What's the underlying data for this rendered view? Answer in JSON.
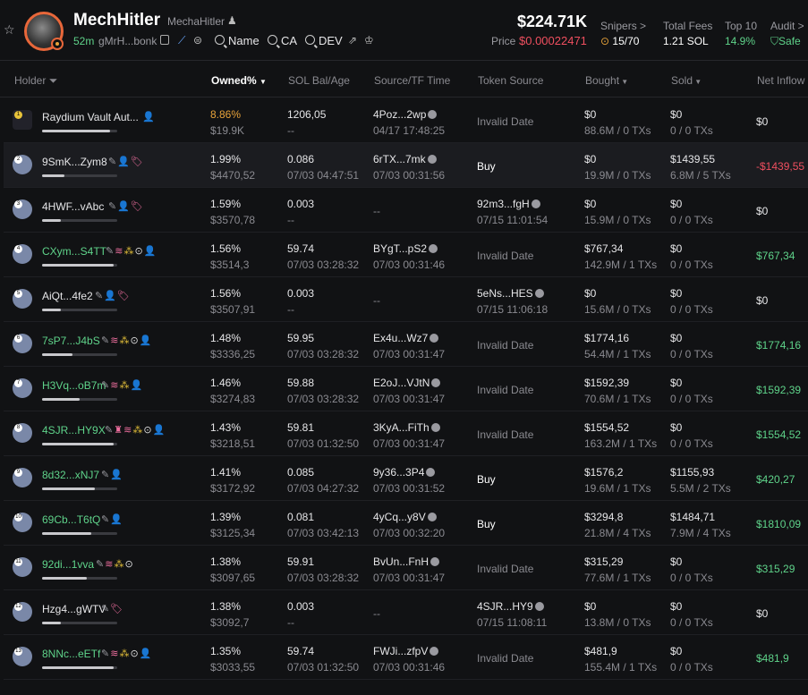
{
  "header": {
    "title": "MechHitler",
    "subtitle": "MechaHitler",
    "age": "52m",
    "ca_short": "gMrH...bonk",
    "name_link": "Name",
    "ca_link": "CA",
    "dev_link": "DEV",
    "market_cap": "$224.71K",
    "price_label": "Price",
    "price_value": "$0.00022471",
    "snipers_label": "Snipers >",
    "snipers_value": "15/70",
    "fees_label": "Total Fees",
    "fees_value": "1.21 SOL",
    "top10_label": "Top 10",
    "top10_value": "14.9%",
    "audit_label": "Audit >",
    "audit_value": "Safe"
  },
  "columns": {
    "holder": "Holder",
    "owned": "Owned%",
    "sol_bal": "SOL Bal/Age",
    "source": "Source/TF Time",
    "token_source": "Token Source",
    "bought": "Bought",
    "sold": "Sold",
    "net": "Net Inflow"
  },
  "rows": [
    {
      "rank": "1",
      "name": "Raydium Vault Aut...",
      "owned": "8.86%",
      "usd": "$19.9K",
      "bal": "1206,05",
      "age": "--",
      "src": "4Poz...2wp",
      "src_time": "04/17 17:48:25",
      "token": "Invalid Date",
      "token_time": "",
      "bought": "$0",
      "bought_sub": "88.6M / 0 TXs",
      "sold": "$0",
      "sold_sub": "0 / 0 TXs",
      "net": "$0",
      "bar": 0.9
    },
    {
      "rank": "2",
      "name": "9SmK...Zym8",
      "owned": "1.99%",
      "usd": "$4470,52",
      "bal": "0.086",
      "age": "07/03 04:47:51",
      "src": "6rTX...7mk",
      "src_time": "07/03 00:31:56",
      "token": "Buy",
      "token_time": "",
      "bought": "$0",
      "bought_sub": "19.9M / 0 TXs",
      "sold": "$1439,55",
      "sold_sub": "6.8M / 5 TXs",
      "net": "-$1439,55",
      "bar": 0.3
    },
    {
      "rank": "3",
      "name": "4HWF...vAbc",
      "owned": "1.59%",
      "usd": "$3570,78",
      "bal": "0.003",
      "age": "--",
      "src": "--",
      "src_time": "",
      "token": "92m3...fgH",
      "token_time": "07/15 11:01:54",
      "bought": "$0",
      "bought_sub": "15.9M / 0 TXs",
      "sold": "$0",
      "sold_sub": "0 / 0 TXs",
      "net": "$0",
      "bar": 0.25
    },
    {
      "rank": "4",
      "name": "CXym...S4TT",
      "owned": "1.56%",
      "usd": "$3514,3",
      "bal": "59.74",
      "age": "07/03 03:28:32",
      "src": "BYgT...pS2",
      "src_time": "07/03 00:31:46",
      "token": "Invalid Date",
      "token_time": "",
      "bought": "$767,34",
      "bought_sub": "142.9M / 1 TXs",
      "sold": "$0",
      "sold_sub": "0 / 0 TXs",
      "net": "$767,34",
      "bar": 0.95
    },
    {
      "rank": "5",
      "name": "AiQt...4fe2",
      "owned": "1.56%",
      "usd": "$3507,91",
      "bal": "0.003",
      "age": "--",
      "src": "--",
      "src_time": "",
      "token": "5eNs...HES",
      "token_time": "07/15 11:06:18",
      "bought": "$0",
      "bought_sub": "15.6M / 0 TXs",
      "sold": "$0",
      "sold_sub": "0 / 0 TXs",
      "net": "$0",
      "bar": 0.25
    },
    {
      "rank": "6",
      "name": "7sP7...J4bS",
      "owned": "1.48%",
      "usd": "$3336,25",
      "bal": "59.95",
      "age": "07/03 03:28:32",
      "src": "Ex4u...Wz7",
      "src_time": "07/03 00:31:47",
      "token": "Invalid Date",
      "token_time": "",
      "bought": "$1774,16",
      "bought_sub": "54.4M / 1 TXs",
      "sold": "$0",
      "sold_sub": "0 / 0 TXs",
      "net": "$1774,16",
      "bar": 0.4
    },
    {
      "rank": "7",
      "name": "H3Vq...oB7m",
      "owned": "1.46%",
      "usd": "$3274,83",
      "bal": "59.88",
      "age": "07/03 03:28:32",
      "src": "E2oJ...VJtN",
      "src_time": "07/03 00:31:47",
      "token": "Invalid Date",
      "token_time": "",
      "bought": "$1592,39",
      "bought_sub": "70.6M / 1 TXs",
      "sold": "$0",
      "sold_sub": "0 / 0 TXs",
      "net": "$1592,39",
      "bar": 0.5
    },
    {
      "rank": "8",
      "name": "4SJR...HY9X",
      "owned": "1.43%",
      "usd": "$3218,51",
      "bal": "59.81",
      "age": "07/03 01:32:50",
      "src": "3KyA...FiTh",
      "src_time": "07/03 00:31:47",
      "token": "Invalid Date",
      "token_time": "",
      "bought": "$1554,52",
      "bought_sub": "163.2M / 1 TXs",
      "sold": "$0",
      "sold_sub": "0 / 0 TXs",
      "net": "$1554,52",
      "bar": 0.95
    },
    {
      "rank": "9",
      "name": "8d32...xNJ7",
      "owned": "1.41%",
      "usd": "$3172,92",
      "bal": "0.085",
      "age": "07/03 04:27:32",
      "src": "9y36...3P4",
      "src_time": "07/03 00:31:52",
      "token": "Buy",
      "token_time": "",
      "bought": "$1576,2",
      "bought_sub": "19.6M / 1 TXs",
      "sold": "$1155,93",
      "sold_sub": "5.5M / 2 TXs",
      "net": "$420,27",
      "bar": 0.7
    },
    {
      "rank": "10",
      "name": "69Cb...T6tQ",
      "owned": "1.39%",
      "usd": "$3125,34",
      "bal": "0.081",
      "age": "07/03 03:42:13",
      "src": "4yCq...y8V",
      "src_time": "07/03 00:32:20",
      "token": "Buy",
      "token_time": "",
      "bought": "$3294,8",
      "bought_sub": "21.8M / 4 TXs",
      "sold": "$1484,71",
      "sold_sub": "7.9M / 4 TXs",
      "net": "$1810,09",
      "bar": 0.65
    },
    {
      "rank": "11",
      "name": "92di...1vva",
      "owned": "1.38%",
      "usd": "$3097,65",
      "bal": "59.91",
      "age": "07/03 03:28:32",
      "src": "BvUn...FnH",
      "src_time": "07/03 00:31:47",
      "token": "Invalid Date",
      "token_time": "",
      "bought": "$315,29",
      "bought_sub": "77.6M / 1 TXs",
      "sold": "$0",
      "sold_sub": "0 / 0 TXs",
      "net": "$315,29",
      "bar": 0.6
    },
    {
      "rank": "12",
      "name": "Hzg4...gWTV",
      "owned": "1.38%",
      "usd": "$3092,7",
      "bal": "0.003",
      "age": "--",
      "src": "--",
      "src_time": "",
      "token": "4SJR...HY9",
      "token_time": "07/15 11:08:11",
      "bought": "$0",
      "bought_sub": "13.8M / 0 TXs",
      "sold": "$0",
      "sold_sub": "0 / 0 TXs",
      "net": "$0",
      "bar": 0.25
    },
    {
      "rank": "13",
      "name": "8NNc...eETf",
      "owned": "1.35%",
      "usd": "$3033,55",
      "bal": "59.74",
      "age": "07/03 01:32:50",
      "src": "FWJi...zfpV",
      "src_time": "07/03 00:31:46",
      "token": "Invalid Date",
      "token_time": "",
      "bought": "$481,9",
      "bought_sub": "155.4M / 1 TXs",
      "sold": "$0",
      "sold_sub": "0 / 0 TXs",
      "net": "$481,9",
      "bar": 0.95
    }
  ],
  "colors": {
    "accent_green": "#5fd38a",
    "accent_red": "#ef4f5f",
    "accent_orange": "#e8a33a"
  }
}
